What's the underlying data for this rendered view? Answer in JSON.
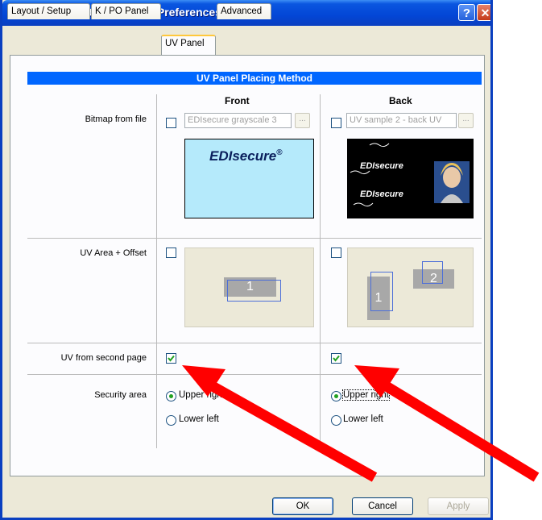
{
  "window": {
    "title": "DIGID XID590ie Printing Preferences",
    "help_label": "?",
    "close_label": "✕"
  },
  "tabs": [
    {
      "label": "Layout / Setup",
      "active": false
    },
    {
      "label": "K / PO Panel",
      "active": false
    },
    {
      "label": "UV Panel",
      "active": true
    },
    {
      "label": "Advanced",
      "active": false
    }
  ],
  "section": {
    "title": "UV Panel Placing Method",
    "front_label": "Front",
    "back_label": "Back"
  },
  "rows": {
    "bitmap_label": "Bitmap from file",
    "uv_area_label": "UV Area + Offset",
    "second_page_label": "UV from second page",
    "security_label": "Security area"
  },
  "front": {
    "bitmap_checked": false,
    "bitmap_file": "EDIsecure grayscale 3",
    "browse_label": "...",
    "preview_logo": "EDIsecure",
    "preview_logo_mark": "®",
    "uv_area_checked": false,
    "uv_box_label": "1",
    "second_page_checked": true,
    "security_options": [
      "Upper right",
      "Lower left"
    ],
    "security_selected": "Upper right"
  },
  "back": {
    "bitmap_checked": false,
    "bitmap_file": "UV sample 2 - back UV",
    "browse_label": "...",
    "preview_logo": "EDIsecure",
    "uv_area_checked": false,
    "uv_box_labels": [
      "1",
      "2"
    ],
    "second_page_checked": true,
    "security_options": [
      "Upper right",
      "Lower left"
    ],
    "security_selected": "Upper right"
  },
  "buttons": {
    "ok": "OK",
    "cancel": "Cancel",
    "apply": "Apply"
  },
  "colors": {
    "section_header": "#0066FF",
    "front_preview_bg": "#B5EAFB",
    "annotation_arrow": "#FF0000"
  }
}
